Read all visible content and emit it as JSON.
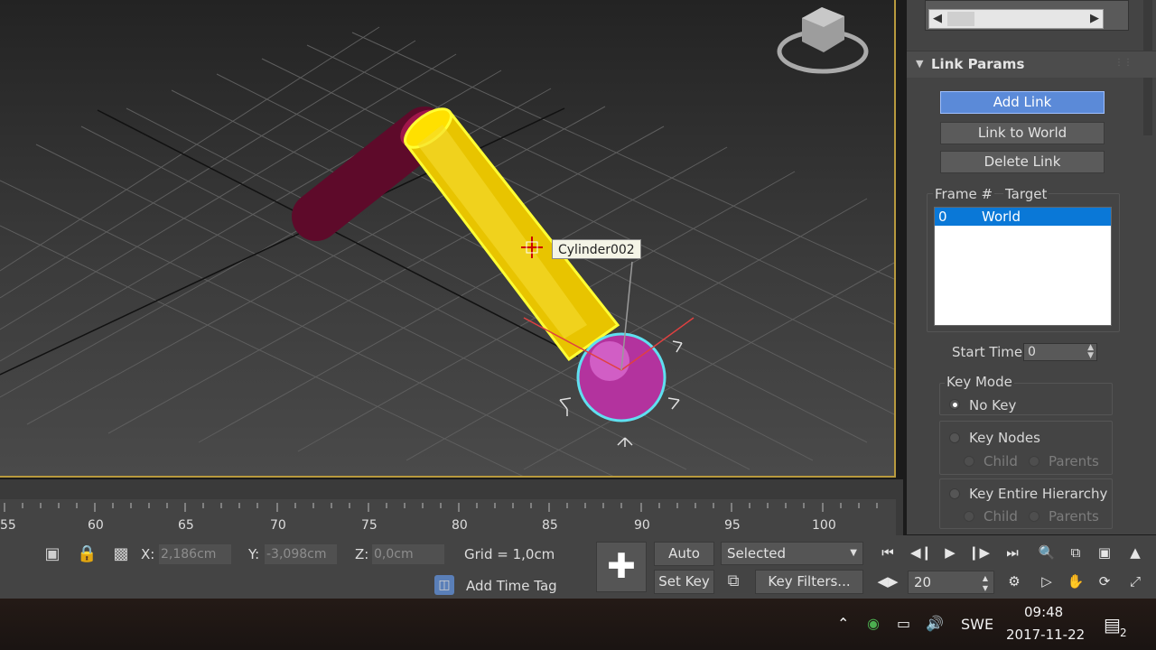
{
  "viewport": {
    "tooltip": "Cylinder002"
  },
  "panel": {
    "rollout_title": "Link Params",
    "add_link": "Add Link",
    "link_to_world": "Link to World",
    "delete_link": "Delete Link",
    "col_frame": "Frame #",
    "col_target": "Target",
    "rows": [
      {
        "frame": "0",
        "target": "World"
      }
    ],
    "start_time_label": "Start Time:",
    "start_time_value": "0",
    "key_mode_label": "Key Mode",
    "no_key": "No Key",
    "key_nodes": "Key Nodes",
    "child": "Child",
    "parents": "Parents",
    "key_entire_hierarchy": "Key Entire Hierarchy",
    "child2": "Child",
    "parents2": "Parents"
  },
  "ruler": {
    "ticks": [
      "55",
      "60",
      "65",
      "70",
      "75",
      "80",
      "85",
      "90",
      "95",
      "100"
    ]
  },
  "status": {
    "x_label": "X:",
    "x_value": "2,186cm",
    "y_label": "Y:",
    "y_value": "-3,098cm",
    "z_label": "Z:",
    "z_value": "0,0cm",
    "grid": "Grid = 1,0cm",
    "add_time_tag": "Add Time Tag",
    "auto_key": "Auto Key",
    "set_key": "Set Key",
    "selected": "Selected",
    "key_filters": "Key Filters...",
    "frame_value": "20"
  },
  "taskbar": {
    "lang": "SWE",
    "time": "09:48",
    "date": "2017-11-22",
    "notifications": "2"
  },
  "colors": {
    "accent_blue": "#5b8ad8",
    "selection": "#0a78d7",
    "viewport_border": "#b89a3e"
  }
}
